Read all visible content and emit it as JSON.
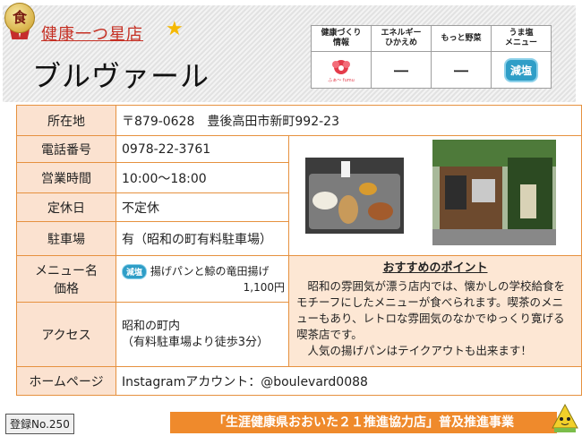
{
  "header": {
    "badge_char": "食",
    "subtitle": "健康一つ星店",
    "shop_name": "ブルヴァール"
  },
  "icon_table": {
    "headers": [
      "健康づくり\n情報",
      "エネルギー\nひかえめ",
      "もっと野菜",
      "うま塩\nメニュー"
    ],
    "values": [
      "",
      "ー",
      "ー",
      "減塩"
    ],
    "icon_caption": "ふぁ〜 fumu"
  },
  "info": {
    "address_label": "所在地",
    "address": "〒879-0628　豊後高田市新町992-23",
    "phone_label": "電話番号",
    "phone": "0978-22-3761",
    "hours_label": "営業時間",
    "hours": "10:00〜18:00",
    "closed_label": "定休日",
    "closed": "不定休",
    "parking_label": "駐車場",
    "parking": "有（昭和の町有料駐車場）",
    "menu_label_1": "メニュー名",
    "menu_label_2": "価格",
    "menu_icon": "減塩",
    "menu_name": "揚げパンと鯨の竜田揚げ",
    "menu_price": "1,100円",
    "access_label": "アクセス",
    "access_1": "昭和の町内",
    "access_2": "（有料駐車場より徒歩3分）",
    "homepage_label": "ホームページ",
    "homepage": "Instagramアカウント：@boulevard0088"
  },
  "recommend": {
    "title": "おすすめのポイント",
    "body": "　昭和の雰囲気が漂う店内では、懐かしの学校給食をモチーフにしたメニューが食べられます。喫茶のメニューもあり、レトロな雰囲気のなかでゆっくり寛げる喫茶店です。\n　人気の揚げパンはテイクアウトも出来ます！"
  },
  "footer": {
    "reg_no": "登録No.250",
    "banner": "「生涯健康県おおいた２１推進協力店」普及推進事業"
  },
  "colors": {
    "accent": "#e6913f",
    "label_bg": "#fbe2d0",
    "recommend_bg": "#fde7d4",
    "banner": "#ef8a2c",
    "title_red": "#c53024"
  }
}
